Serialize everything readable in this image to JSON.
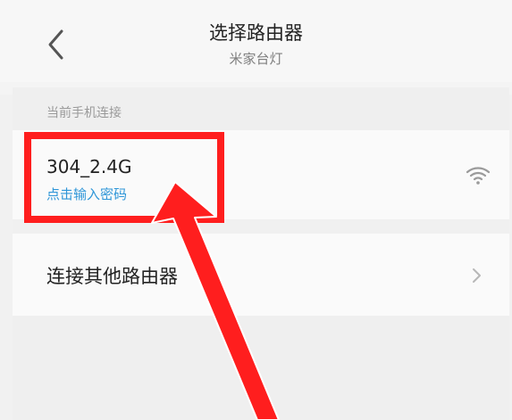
{
  "header": {
    "title": "选择路由器",
    "subtitle": "米家台灯",
    "back_icon": "chevron-left-icon"
  },
  "current_connection": {
    "section_label": "当前手机连接",
    "wifi_name": "304_2.4G",
    "action_text": "点击输入密码",
    "signal_icon": "wifi-icon",
    "action_color": "#2f96d8"
  },
  "other_router": {
    "label": "连接其他路由器",
    "arrow_icon": "chevron-right-icon"
  },
  "annotation": {
    "color": "#ff1e1e",
    "shape": "box-and-arrow"
  }
}
